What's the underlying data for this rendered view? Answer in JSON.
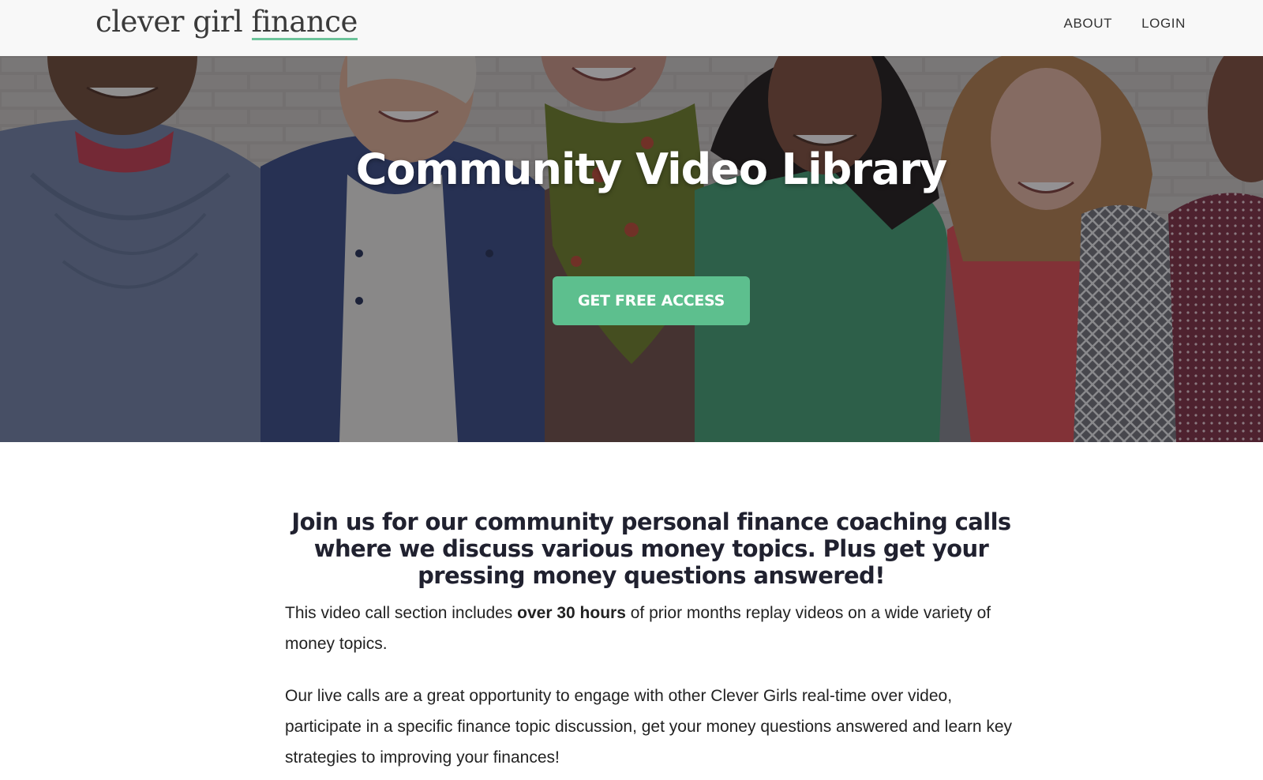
{
  "header": {
    "logo": {
      "text_before": "clever girl ",
      "text_accent": "finance"
    },
    "nav": [
      {
        "label": "ABOUT"
      },
      {
        "label": "LOGIN"
      }
    ]
  },
  "hero": {
    "title": "Community Video Library",
    "cta_label": "GET FREE ACCESS"
  },
  "content": {
    "heading": "Join us for our community personal finance coaching calls where we discuss various money topics. Plus get your pressing money questions answered!",
    "para1": {
      "before": "This video call section includes ",
      "bold": "over 30 hours",
      "after": " of prior months replay videos on a wide variety of money topics."
    },
    "para2": "Our live calls are a great opportunity to engage with other Clever Girls real-time over video, participate in a specific finance topic discussion, get your money questions answered and learn key strategies to improving your finances!"
  },
  "colors": {
    "accent_green": "#5dbf8e",
    "logo_underline": "#6cc39a",
    "header_bg": "#f8f8f8",
    "heading_text": "#20212f"
  }
}
